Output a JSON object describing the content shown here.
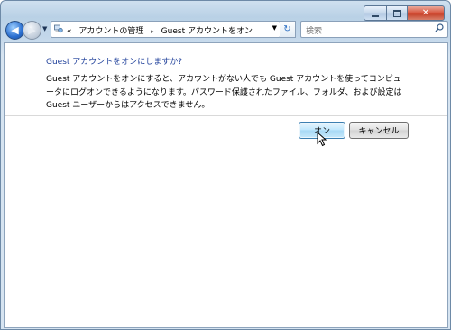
{
  "window": {
    "caption_buttons": [
      "minimize-icon",
      "maximize-icon",
      "close-icon"
    ],
    "colors": {
      "frame": "#b9d1e6",
      "close_button": "#c43a22",
      "heading": "#1e3f9a"
    }
  },
  "nav": {
    "back_icon": "back-arrow-icon",
    "forward_icon": "forward-arrow-icon",
    "address": {
      "overflow": "«",
      "crumbs": [
        "アカウントの管理",
        "Guest アカウントをオン"
      ],
      "separator": "▸"
    },
    "refresh_icon": "refresh-icon",
    "search": {
      "placeholder": "検索",
      "icon": "search-icon"
    }
  },
  "content": {
    "heading": "Guest アカウントをオンにしますか?",
    "description": "Guest アカウントをオンにすると、アカウントがない人でも Guest アカウントを使ってコンピュータにログオンできるようになります。パスワード保護されたファイル、フォルダ、および設定は Guest ユーザーからはアクセスできません。",
    "buttons": {
      "on": "オン",
      "cancel": "キャンセル"
    }
  }
}
